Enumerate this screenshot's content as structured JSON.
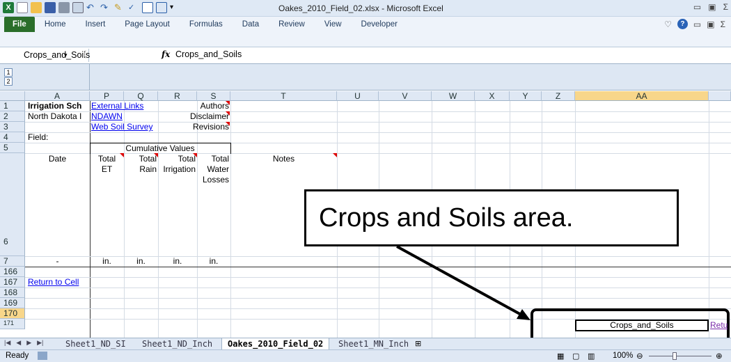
{
  "window": {
    "title": "Oakes_2010_Field_02.xlsx - Microsoft Excel"
  },
  "ribbon": {
    "tabs": [
      "File",
      "Home",
      "Insert",
      "Page Layout",
      "Formulas",
      "Data",
      "Review",
      "View",
      "Developer"
    ],
    "accent": "#2a6e2a"
  },
  "formula_bar": {
    "name_box": "Crops_and_Soils",
    "fx": "fx",
    "content": "Crops_and_Soils"
  },
  "outline": {
    "levels": [
      "1",
      "2"
    ]
  },
  "columns": [
    "A",
    "P",
    "Q",
    "R",
    "S",
    "T",
    "U",
    "V",
    "W",
    "X",
    "Y",
    "Z",
    "AA"
  ],
  "selected_column": "AA",
  "rows": [
    "1",
    "2",
    "3",
    "4",
    "5",
    "6",
    "7",
    "166",
    "167",
    "168",
    "169",
    "170",
    "171"
  ],
  "selected_row": "170",
  "cells": {
    "a1": "Irrigation Sch",
    "a2": "North Dakota I",
    "a4": "Field:",
    "p1": "External Links",
    "p2": "NDAWN",
    "p3": "Web Soil Survey",
    "s1": "Authors",
    "s2": "Disclaimer",
    "s3": "Revisions",
    "p5": "Cumulative Values",
    "a6": "Date",
    "p6": "Total",
    "p6b": "ET",
    "q6": "Total",
    "q6b": "Rain",
    "r6": "Total",
    "r6b": "Irrigation",
    "s6": "Total",
    "s6b": "Water",
    "s6c": "Losses",
    "t6": "Notes",
    "a7": "-",
    "p7": "in.",
    "q7": "in.",
    "r7": "in.",
    "s7": "in.",
    "a167": "Return to Cell",
    "aa170": "Crops_and_Soils",
    "ab170": "Retu"
  },
  "callout": {
    "text": "Crops and Soils area."
  },
  "sheets": [
    "Sheet1_ND_SI",
    "Sheet1_ND_Inch",
    "Oakes_2010_Field_02",
    "Sheet1_MN_Inch"
  ],
  "active_sheet": "Oakes_2010_Field_02",
  "status": {
    "ready": "Ready",
    "zoom": "100%"
  }
}
